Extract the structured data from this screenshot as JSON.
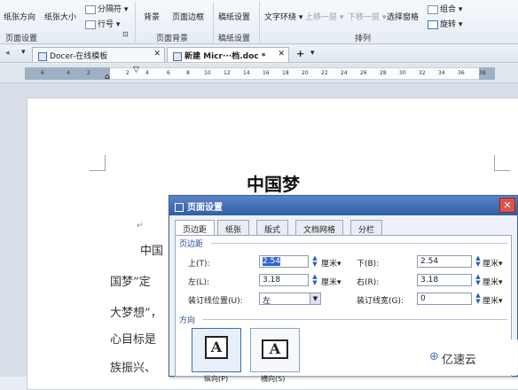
{
  "ribbon": {
    "buttons": {
      "paper_direction": "纸张方向",
      "paper_size": "纸张大小",
      "separator": "分隔符",
      "line_number": "行号",
      "background": "背景",
      "page_border": "页面边框",
      "manuscript_setting": "稿纸设置",
      "text_wrap": "文字环绕",
      "bring_forward": "上移一层",
      "send_backward": "下移一层",
      "selection_pane": "选择窗格",
      "group": "组合",
      "rotate": "旋转"
    },
    "groups": {
      "page_setup": "页面设置",
      "page_background": "页面背景",
      "manuscript": "稿纸设置",
      "arrange": "排列"
    }
  },
  "tabs": {
    "docer": "Docer-在线模板",
    "document": "新建 Micr···档.doc *",
    "add": "+"
  },
  "ruler": {
    "ticks": [
      "6",
      "4",
      "2",
      "2",
      "4",
      "6",
      "8",
      "10",
      "12",
      "14",
      "16",
      "18",
      "20",
      "22",
      "24",
      "26",
      "28",
      "30",
      "32",
      "34",
      "36",
      "38"
    ]
  },
  "document": {
    "title": "中国梦",
    "lines": [
      "中国",
      "国梦”定",
      "大梦想”，",
      "心目标是",
      "族振兴、"
    ]
  },
  "dialog": {
    "title": "页面设置",
    "close": "✕",
    "tabs": [
      "页边距",
      "纸张",
      "版式",
      "文档网格",
      "分栏"
    ],
    "section_margins": "页边距",
    "top_label": "上(T):",
    "top_value": "2.54",
    "bottom_label": "下(B):",
    "bottom_value": "2.54",
    "left_label": "左(L):",
    "left_value": "3.18",
    "right_label": "右(R):",
    "right_value": "3.18",
    "unit": "厘米▾",
    "gutter_pos_label": "装订线位置(U):",
    "gutter_pos_value": "左",
    "gutter_width_label": "装订线宽(G):",
    "gutter_width_value": "0",
    "section_orientation": "方向",
    "portrait": "纵向(P)",
    "landscape": "横向(S)"
  },
  "watermark": {
    "text": "亿速云"
  },
  "colors": {
    "dialog_title": "#2f5ea8",
    "accent": "#3366cc"
  }
}
